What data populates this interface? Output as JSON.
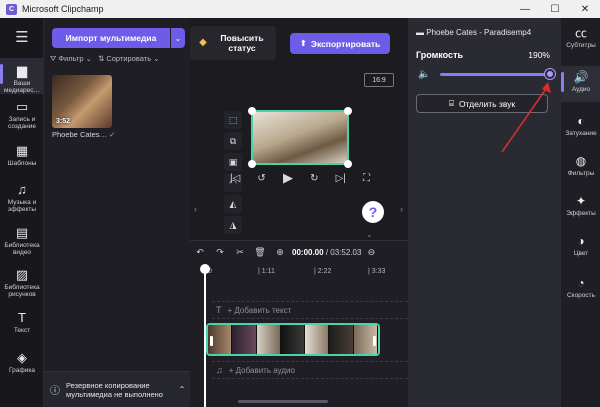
{
  "window": {
    "title": "Microsoft Clipchamp",
    "minimize": "—",
    "maximize": "☐",
    "close": "✕"
  },
  "left_rail": {
    "menu_icon": "☰",
    "items": [
      {
        "icon": "▆",
        "label": "Ваши медиарес…"
      },
      {
        "icon": "▭",
        "label": "Запись и создание"
      },
      {
        "icon": "▦",
        "label": "Шаблоны"
      },
      {
        "icon": "♫",
        "label": "Музыка и эффекты"
      },
      {
        "icon": "▤",
        "label": "Библиотека видео"
      },
      {
        "icon": "▨",
        "label": "Библиотека рисунков"
      },
      {
        "icon": "T",
        "label": "Текст"
      },
      {
        "icon": "◈",
        "label": "Графика"
      }
    ]
  },
  "media": {
    "import_label": "Импорт мультимедиа",
    "dropdown_icon": "⌄",
    "filter_label": "Фильтр",
    "sort_label": "Сортировать",
    "thumb_duration": "3:52",
    "thumb_name": "Phoebe Cates…",
    "thumb_check": "✓",
    "backup_text": "Резервное копирование мультимедиа не выполнено",
    "backup_icon": "ⓘ",
    "backup_chevron": "⌃"
  },
  "header": {
    "upgrade_label": "Повысить статус",
    "upgrade_icon": "◆",
    "export_label": "Экспортировать",
    "export_icon": "⬆"
  },
  "preview": {
    "aspect_ratio": "16:9",
    "help_icon": "?",
    "tools": [
      "⬚",
      "⧉",
      "▣",
      "◠",
      "◭",
      "◮"
    ],
    "controls": [
      "|◁",
      "↺",
      "▶",
      "↻",
      "▷|",
      "⛶"
    ]
  },
  "timeline": {
    "undo": "↶",
    "redo": "↷",
    "cut": "✂",
    "delete": "🗑",
    "add": "⊕",
    "current_time": "00:00.00",
    "total_time": "/ 03:52.03",
    "zoom_out": "⊖",
    "ruler": [
      "0",
      "| 1:11",
      "| 2:22",
      "| 3:33"
    ],
    "add_text": "+ Добавить текст",
    "add_audio": "+ Добавить аудио"
  },
  "properties": {
    "file_name": "Phoebe Cates - Paradisemp4",
    "volume_label": "Громкость",
    "volume_value": "190%",
    "volume_fraction": 0.95,
    "detach_label": "Отделить звук",
    "detach_icon": "⌸"
  },
  "right_rail": {
    "items": [
      {
        "icon": "㏄",
        "label": "Субтитры"
      },
      {
        "icon": "🔊",
        "label": "Аудио"
      },
      {
        "icon": "◐",
        "label": "Затухание"
      },
      {
        "icon": "◍",
        "label": "Фильтры"
      },
      {
        "icon": "✦",
        "label": "Эффекты"
      },
      {
        "icon": "◑",
        "label": "Цвет"
      },
      {
        "icon": "◔",
        "label": "Скорость"
      }
    ]
  },
  "colors": {
    "accent": "#6d5ce7",
    "selection": "#4bd3a8",
    "annotation_arrow": "#d32f2f"
  }
}
